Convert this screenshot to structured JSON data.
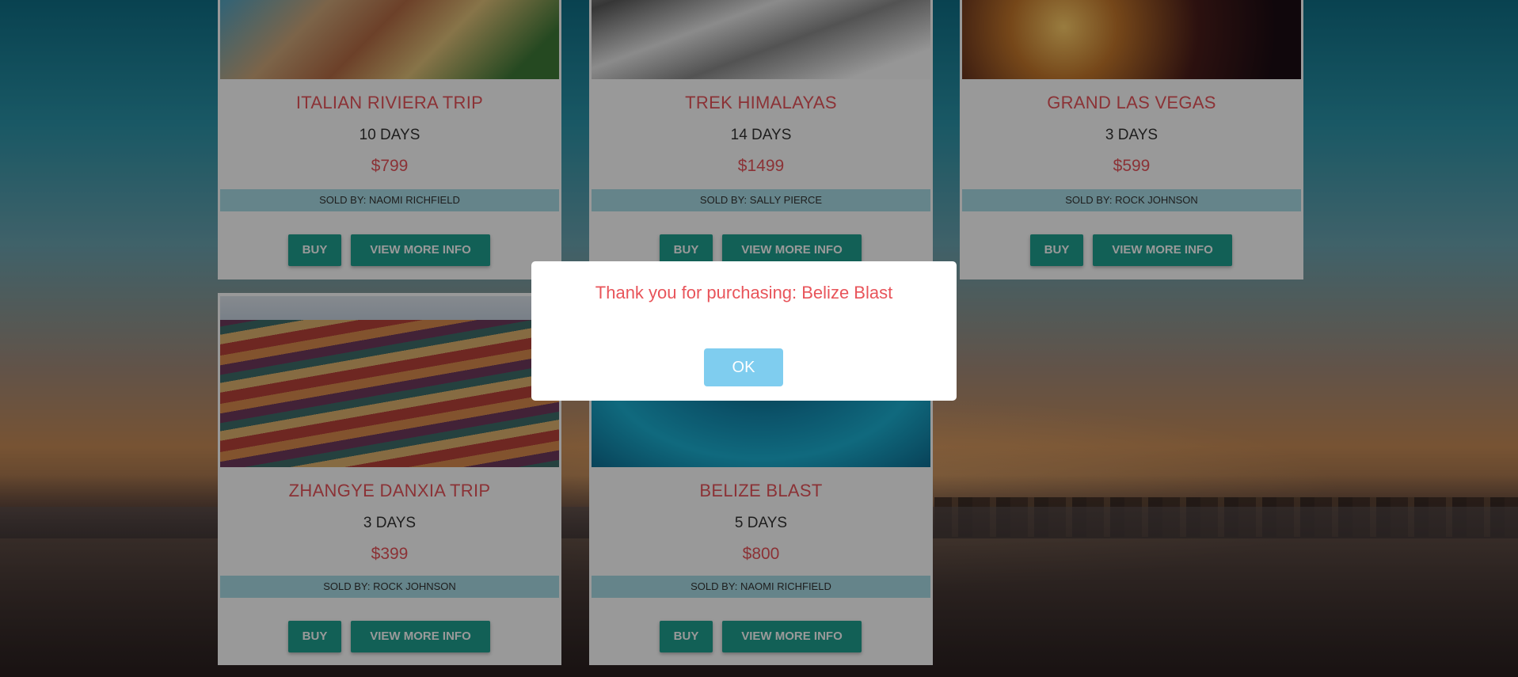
{
  "cards": [
    {
      "title": "ITALIAN RIVIERA TRIP",
      "days": "10 DAYS",
      "price": "$799",
      "seller": "SOLD BY: NAOMI RICHFIELD",
      "buy_label": "BUY",
      "info_label": "VIEW MORE INFO"
    },
    {
      "title": "TREK HIMALAYAS",
      "days": "14 DAYS",
      "price": "$1499",
      "seller": "SOLD BY: SALLY PIERCE",
      "buy_label": "BUY",
      "info_label": "VIEW MORE INFO"
    },
    {
      "title": "GRAND LAS VEGAS",
      "days": "3 DAYS",
      "price": "$599",
      "seller": "SOLD BY: ROCK JOHNSON",
      "buy_label": "BUY",
      "info_label": "VIEW MORE INFO"
    },
    {
      "title": "ZHANGYE DANXIA TRIP",
      "days": "3 DAYS",
      "price": "$399",
      "seller": "SOLD BY: ROCK JOHNSON",
      "buy_label": "BUY",
      "info_label": "VIEW MORE INFO"
    },
    {
      "title": "BELIZE BLAST",
      "days": "5 DAYS",
      "price": "$800",
      "seller": "SOLD BY: NAOMI RICHFIELD",
      "buy_label": "BUY",
      "info_label": "VIEW MORE INFO"
    }
  ],
  "modal": {
    "message": "Thank you for purchasing: Belize Blast",
    "ok_label": "OK"
  },
  "colors": {
    "accent_text": "#e8545a",
    "button": "#1fa08f",
    "seller_band": "#a8dde6",
    "ok_button": "#7fcdef"
  }
}
